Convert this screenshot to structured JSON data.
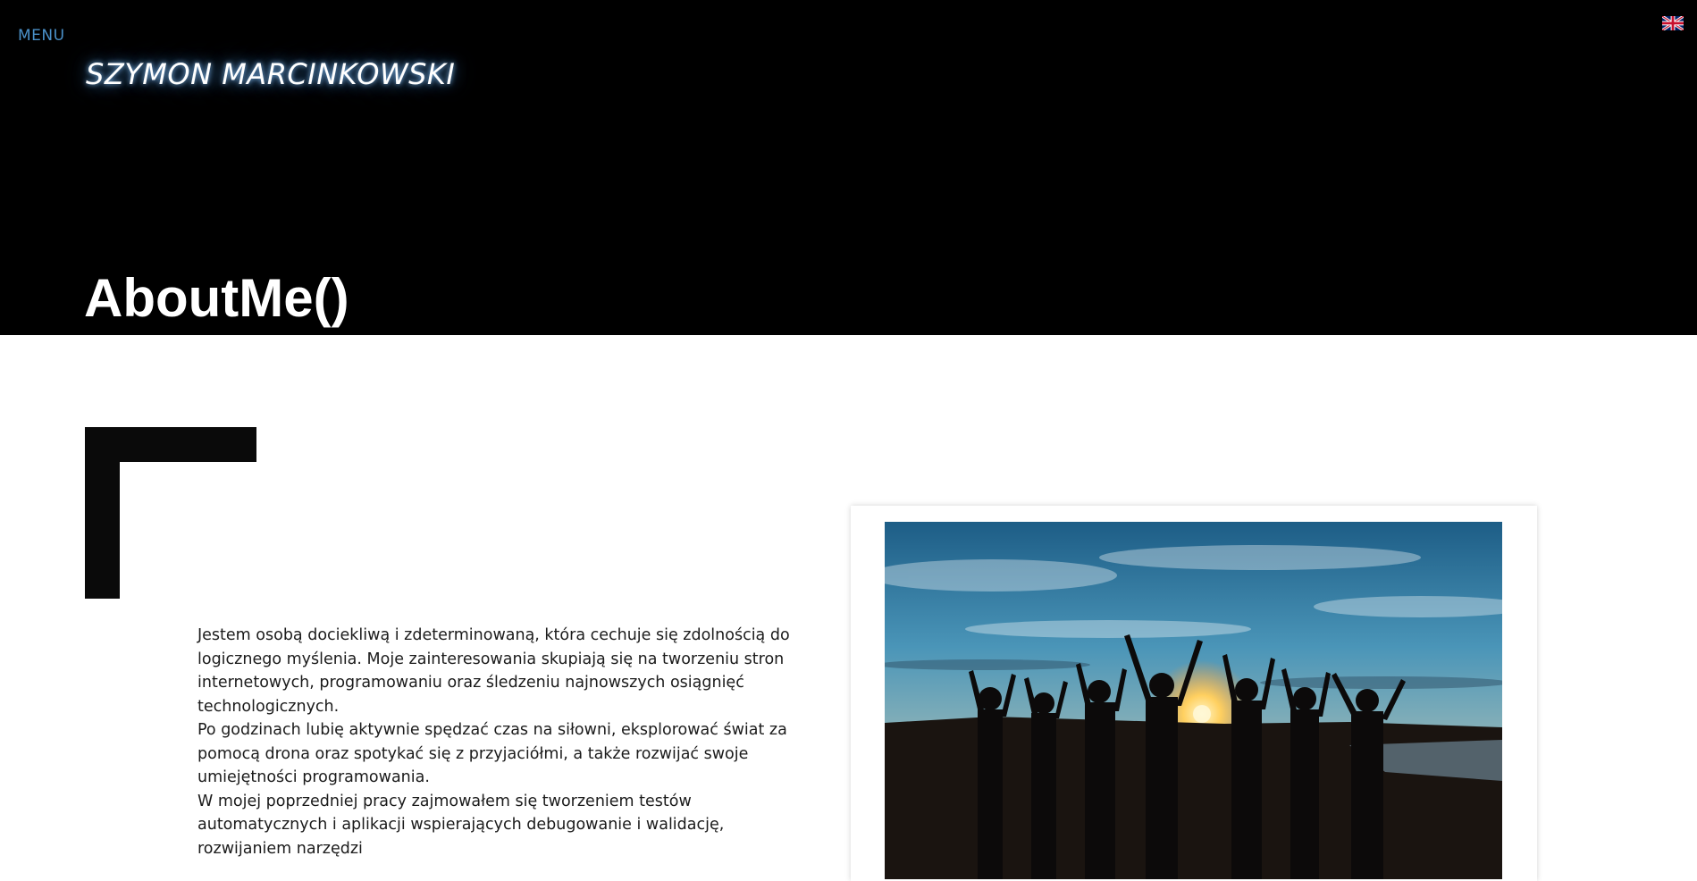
{
  "nav": {
    "menu_label": "MENU",
    "language_icon": "uk-flag-icon"
  },
  "header": {
    "brand": "SZYMON MARCINKOWSKI",
    "page_title": "AboutMe()"
  },
  "about": {
    "paragraphs": [
      "Jestem osobą dociekliwą i zdeterminowaną, która cechuje się zdolnością do logicznego myślenia. Moje zainteresowania skupiają się na tworzeniu stron internetowych, programowaniu oraz śledzeniu najnowszych osiągnięć technologicznych.",
      "Po godzinach lubię aktywnie spędzać czas na siłowni, eksplorować świat za pomocą drona oraz spotykać się z przyjaciółmi, a także rozwijać swoje umiejętności programowania.",
      "W mojej poprzedniej pracy zajmowałem się tworzeniem testów automatycznych i aplikacji wspierających debugowanie i walidację, rozwijaniem narzędzi"
    ],
    "photo_icon": "sunset-friends-photo"
  },
  "colors": {
    "hero_background": "#000000",
    "menu_link": "#4a90c8",
    "brand_glow": "#8cc8ff",
    "bracket": "#0a0a0a"
  }
}
